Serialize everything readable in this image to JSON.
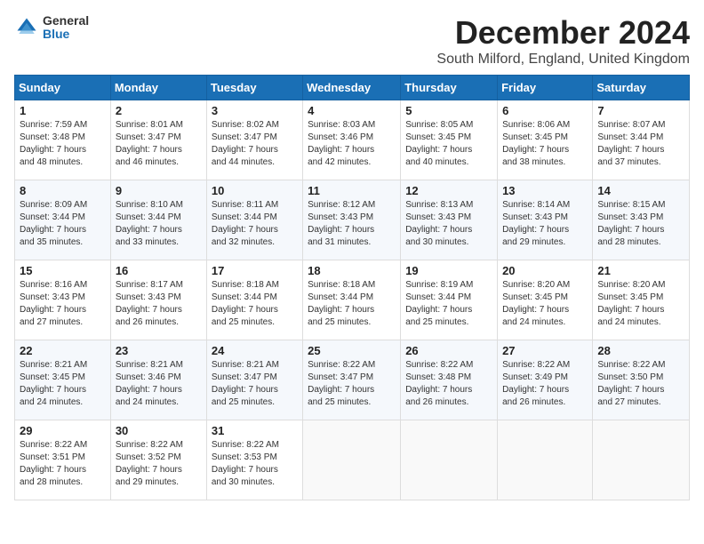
{
  "logo": {
    "general": "General",
    "blue": "Blue"
  },
  "title": {
    "month": "December 2024",
    "location": "South Milford, England, United Kingdom"
  },
  "headers": [
    "Sunday",
    "Monday",
    "Tuesday",
    "Wednesday",
    "Thursday",
    "Friday",
    "Saturday"
  ],
  "weeks": [
    [
      {
        "day": "1",
        "info": "Sunrise: 7:59 AM\nSunset: 3:48 PM\nDaylight: 7 hours\nand 48 minutes."
      },
      {
        "day": "2",
        "info": "Sunrise: 8:01 AM\nSunset: 3:47 PM\nDaylight: 7 hours\nand 46 minutes."
      },
      {
        "day": "3",
        "info": "Sunrise: 8:02 AM\nSunset: 3:47 PM\nDaylight: 7 hours\nand 44 minutes."
      },
      {
        "day": "4",
        "info": "Sunrise: 8:03 AM\nSunset: 3:46 PM\nDaylight: 7 hours\nand 42 minutes."
      },
      {
        "day": "5",
        "info": "Sunrise: 8:05 AM\nSunset: 3:45 PM\nDaylight: 7 hours\nand 40 minutes."
      },
      {
        "day": "6",
        "info": "Sunrise: 8:06 AM\nSunset: 3:45 PM\nDaylight: 7 hours\nand 38 minutes."
      },
      {
        "day": "7",
        "info": "Sunrise: 8:07 AM\nSunset: 3:44 PM\nDaylight: 7 hours\nand 37 minutes."
      }
    ],
    [
      {
        "day": "8",
        "info": "Sunrise: 8:09 AM\nSunset: 3:44 PM\nDaylight: 7 hours\nand 35 minutes."
      },
      {
        "day": "9",
        "info": "Sunrise: 8:10 AM\nSunset: 3:44 PM\nDaylight: 7 hours\nand 33 minutes."
      },
      {
        "day": "10",
        "info": "Sunrise: 8:11 AM\nSunset: 3:44 PM\nDaylight: 7 hours\nand 32 minutes."
      },
      {
        "day": "11",
        "info": "Sunrise: 8:12 AM\nSunset: 3:43 PM\nDaylight: 7 hours\nand 31 minutes."
      },
      {
        "day": "12",
        "info": "Sunrise: 8:13 AM\nSunset: 3:43 PM\nDaylight: 7 hours\nand 30 minutes."
      },
      {
        "day": "13",
        "info": "Sunrise: 8:14 AM\nSunset: 3:43 PM\nDaylight: 7 hours\nand 29 minutes."
      },
      {
        "day": "14",
        "info": "Sunrise: 8:15 AM\nSunset: 3:43 PM\nDaylight: 7 hours\nand 28 minutes."
      }
    ],
    [
      {
        "day": "15",
        "info": "Sunrise: 8:16 AM\nSunset: 3:43 PM\nDaylight: 7 hours\nand 27 minutes."
      },
      {
        "day": "16",
        "info": "Sunrise: 8:17 AM\nSunset: 3:43 PM\nDaylight: 7 hours\nand 26 minutes."
      },
      {
        "day": "17",
        "info": "Sunrise: 8:18 AM\nSunset: 3:44 PM\nDaylight: 7 hours\nand 25 minutes."
      },
      {
        "day": "18",
        "info": "Sunrise: 8:18 AM\nSunset: 3:44 PM\nDaylight: 7 hours\nand 25 minutes."
      },
      {
        "day": "19",
        "info": "Sunrise: 8:19 AM\nSunset: 3:44 PM\nDaylight: 7 hours\nand 25 minutes."
      },
      {
        "day": "20",
        "info": "Sunrise: 8:20 AM\nSunset: 3:45 PM\nDaylight: 7 hours\nand 24 minutes."
      },
      {
        "day": "21",
        "info": "Sunrise: 8:20 AM\nSunset: 3:45 PM\nDaylight: 7 hours\nand 24 minutes."
      }
    ],
    [
      {
        "day": "22",
        "info": "Sunrise: 8:21 AM\nSunset: 3:45 PM\nDaylight: 7 hours\nand 24 minutes."
      },
      {
        "day": "23",
        "info": "Sunrise: 8:21 AM\nSunset: 3:46 PM\nDaylight: 7 hours\nand 24 minutes."
      },
      {
        "day": "24",
        "info": "Sunrise: 8:21 AM\nSunset: 3:47 PM\nDaylight: 7 hours\nand 25 minutes."
      },
      {
        "day": "25",
        "info": "Sunrise: 8:22 AM\nSunset: 3:47 PM\nDaylight: 7 hours\nand 25 minutes."
      },
      {
        "day": "26",
        "info": "Sunrise: 8:22 AM\nSunset: 3:48 PM\nDaylight: 7 hours\nand 26 minutes."
      },
      {
        "day": "27",
        "info": "Sunrise: 8:22 AM\nSunset: 3:49 PM\nDaylight: 7 hours\nand 26 minutes."
      },
      {
        "day": "28",
        "info": "Sunrise: 8:22 AM\nSunset: 3:50 PM\nDaylight: 7 hours\nand 27 minutes."
      }
    ],
    [
      {
        "day": "29",
        "info": "Sunrise: 8:22 AM\nSunset: 3:51 PM\nDaylight: 7 hours\nand 28 minutes."
      },
      {
        "day": "30",
        "info": "Sunrise: 8:22 AM\nSunset: 3:52 PM\nDaylight: 7 hours\nand 29 minutes."
      },
      {
        "day": "31",
        "info": "Sunrise: 8:22 AM\nSunset: 3:53 PM\nDaylight: 7 hours\nand 30 minutes."
      },
      {
        "day": "",
        "info": ""
      },
      {
        "day": "",
        "info": ""
      },
      {
        "day": "",
        "info": ""
      },
      {
        "day": "",
        "info": ""
      }
    ]
  ]
}
